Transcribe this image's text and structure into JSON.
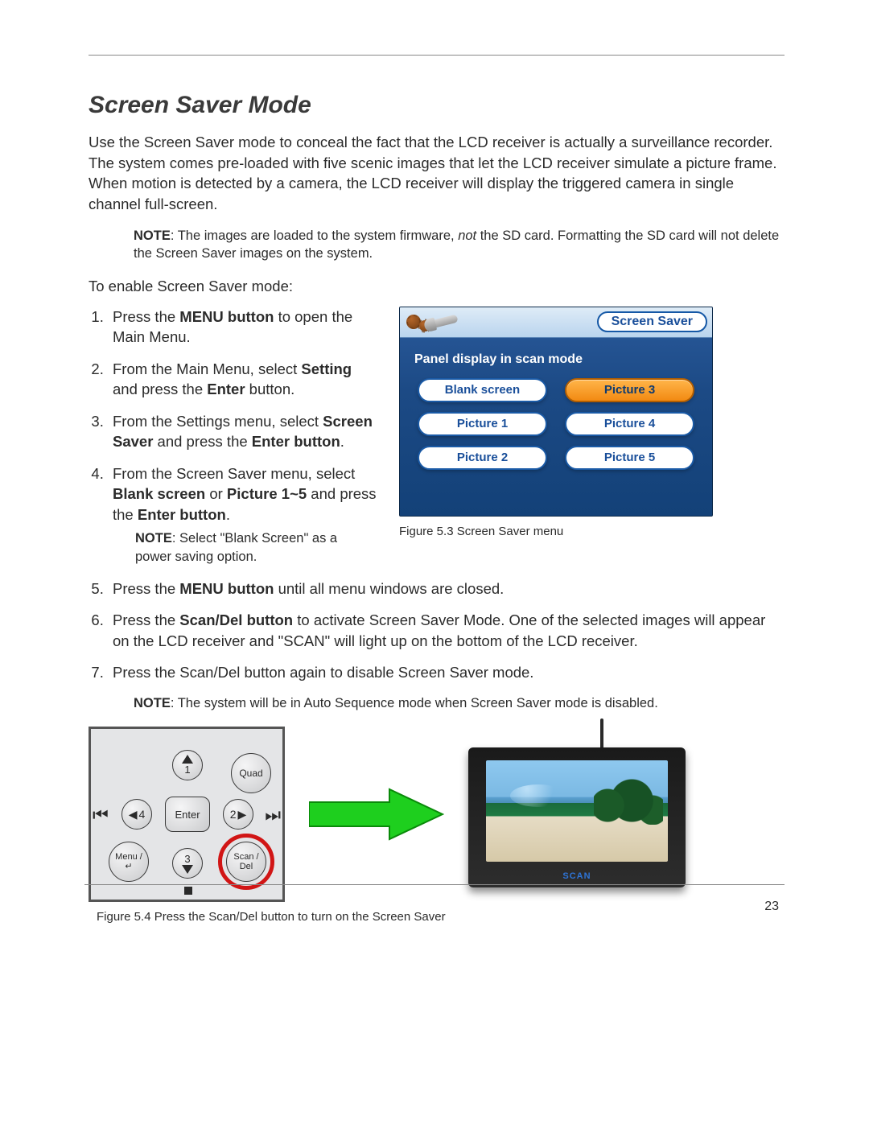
{
  "page_number": "23",
  "section_title": "Screen Saver Mode",
  "intro_paragraph": "Use the Screen Saver mode to conceal the fact that the LCD receiver is actually a surveillance recorder. The system comes pre-loaded with five scenic images that let the LCD receiver simulate a picture frame. When motion is detected by a camera, the LCD receiver will display the triggered camera in single channel full-screen.",
  "note1": {
    "label": "NOTE",
    "before_italic": ": The images are loaded to the system firmware, ",
    "italic_word": "not",
    "after_italic": " the SD card. Formatting the SD card will not delete the Screen Saver images on the system."
  },
  "enable_line": "To enable Screen Saver mode:",
  "steps": {
    "s1a": "Press the ",
    "s1b": "MENU button",
    "s1c": " to open the Main Menu.",
    "s2a": "From the Main Menu, select ",
    "s2b": "Setting",
    "s2c": " and press the ",
    "s2d": "Enter",
    "s2e": " button.",
    "s3a": "From the Settings menu, select ",
    "s3b": "Screen Saver",
    "s3c": " and press the ",
    "s3d": "Enter button",
    "s3e": ".",
    "s4a": "From the Screen Saver menu, select ",
    "s4b": "Blank screen",
    "s4c": " or ",
    "s4d": "Picture 1~5",
    "s4e": " and press the ",
    "s4f": "Enter button",
    "s4g": ".",
    "s4_note_label": "NOTE",
    "s4_note_text": ": Select \"Blank Screen\" as a power saving option.",
    "s5a": "Press the ",
    "s5b": "MENU button",
    "s5c": " until all menu windows are closed.",
    "s6a": "Press the ",
    "s6b": "Scan/Del button",
    "s6c": " to activate Screen Saver Mode. One of the selected images will appear on the LCD receiver and \"SCAN\" will light up on the bottom of the LCD receiver.",
    "s7": "Press the Scan/Del button again to disable Screen Saver mode."
  },
  "note2": {
    "label": "NOTE",
    "text": ": The system will be in Auto Sequence mode when Screen Saver mode is disabled."
  },
  "menu": {
    "title_pill": "Screen Saver",
    "panel_text": "Panel display in scan mode",
    "buttons": [
      "Blank screen",
      "Picture 3",
      "Picture 1",
      "Picture 4",
      "Picture 2",
      "Picture 5"
    ],
    "selected_index": 1,
    "caption": "Figure 5.3 Screen Saver menu"
  },
  "dpad": {
    "up": "1",
    "right": "2",
    "down": "3",
    "left": "4",
    "center": "Enter",
    "tl": "Quad",
    "bl_line1": "Menu /",
    "bl_line2": "↵",
    "br_line1": "Scan /",
    "br_line2": "Del"
  },
  "monitor_scan": "SCAN",
  "fig54_caption": "Figure 5.4 Press the Scan/Del button to turn on the Screen Saver"
}
